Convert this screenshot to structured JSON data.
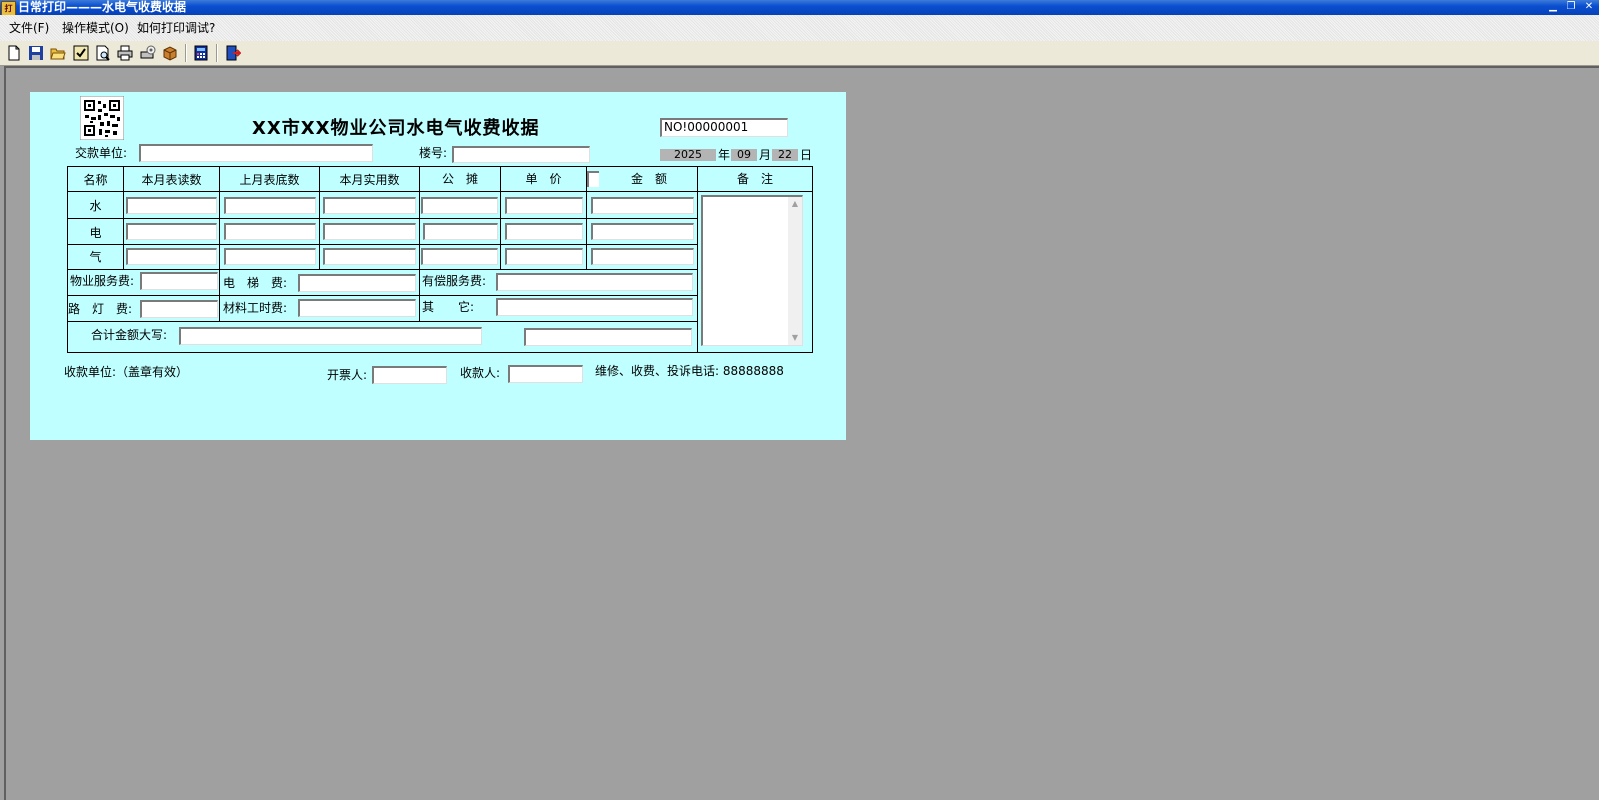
{
  "window": {
    "title": "日常打印———水电气收费收据",
    "app_icon": "打",
    "min_glyph": "▁",
    "restore_glyph": "❐",
    "close_glyph": "✕"
  },
  "menu": [
    "文件(F)",
    "操作模式(O)",
    "如何打印调试?"
  ],
  "toolbar": [
    "new-icon",
    "save-icon",
    "open-icon",
    "check-icon",
    "print-preview-icon",
    "print-icon",
    "print-setup-icon",
    "package-icon",
    "calculator-icon",
    "exit-icon"
  ],
  "receipt": {
    "title": "XX市XX物业公司水电气收费收据",
    "number": "NO!00000001",
    "payer_label": "交款单位:",
    "building_label": "楼号:",
    "date": {
      "year": "2025",
      "year_label": "年",
      "month": "09",
      "month_label": "月",
      "day": "22",
      "day_label": "日"
    },
    "headers": [
      "名称",
      "本月表读数",
      "上月表底数",
      "本月实用数",
      "公　摊",
      "单　价",
      "金　额",
      "备　注"
    ],
    "rows": [
      "水",
      "电",
      "气"
    ],
    "fees": {
      "property": "物业服务费:",
      "elevator": "电　梯　费:",
      "paid_service": "有偿服务费:",
      "streetlight": "路　灯　费:",
      "material": "材料工时费:",
      "other": "其　　它:"
    },
    "total_label": "合计金额大写:",
    "issuer_unit": "收款单位:（盖章有效）",
    "drawer_label": "开票人:",
    "cashier_label": "收款人:",
    "hotline": "维修、收费、投诉电话: 88888888",
    "scroll_up": "▲",
    "scroll_down": "▼"
  }
}
